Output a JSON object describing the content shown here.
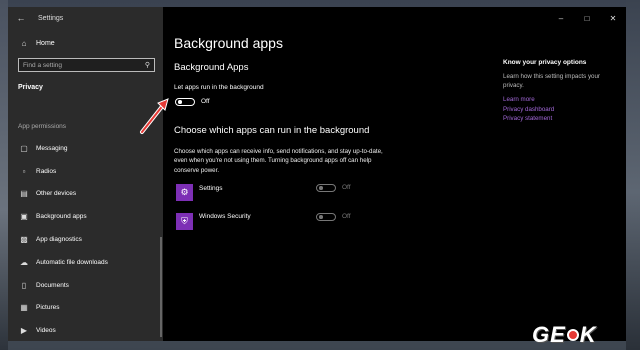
{
  "window": {
    "title": "Settings"
  },
  "sidebar": {
    "home": "Home",
    "search_placeholder": "Find a setting",
    "section": "Privacy",
    "group": "App permissions",
    "items": [
      {
        "label": "Messaging",
        "icon": "chat-icon"
      },
      {
        "label": "Radios",
        "icon": "radio-icon"
      },
      {
        "label": "Other devices",
        "icon": "devices-icon"
      },
      {
        "label": "Background apps",
        "icon": "background-apps-icon"
      },
      {
        "label": "App diagnostics",
        "icon": "diagnostics-icon"
      },
      {
        "label": "Automatic file downloads",
        "icon": "cloud-icon"
      },
      {
        "label": "Documents",
        "icon": "document-icon"
      },
      {
        "label": "Pictures",
        "icon": "picture-icon"
      },
      {
        "label": "Videos",
        "icon": "video-icon"
      }
    ]
  },
  "main": {
    "title": "Background apps",
    "section_title": "Background Apps",
    "toggle_label": "Let apps run in the background",
    "toggle_state": "Off",
    "choose_title": "Choose which apps can run in the background",
    "description": "Choose which apps can receive info, send notifications, and stay up-to-date, even when you're not using them. Turning background apps off can help conserve power.",
    "apps": [
      {
        "name": "Settings",
        "state": "Off",
        "icon": "gear-icon"
      },
      {
        "name": "Windows Security",
        "state": "Off",
        "icon": "shield-icon"
      }
    ]
  },
  "privacy_panel": {
    "title": "Know your privacy options",
    "text": "Learn how this setting impacts your privacy.",
    "links": [
      "Learn more",
      "Privacy dashboard",
      "Privacy statement"
    ]
  },
  "colors": {
    "accent": "#7d2fb5",
    "link": "#a268d8",
    "annotation": "#e53935"
  },
  "watermark": {
    "left": "GE",
    "right": "K"
  }
}
